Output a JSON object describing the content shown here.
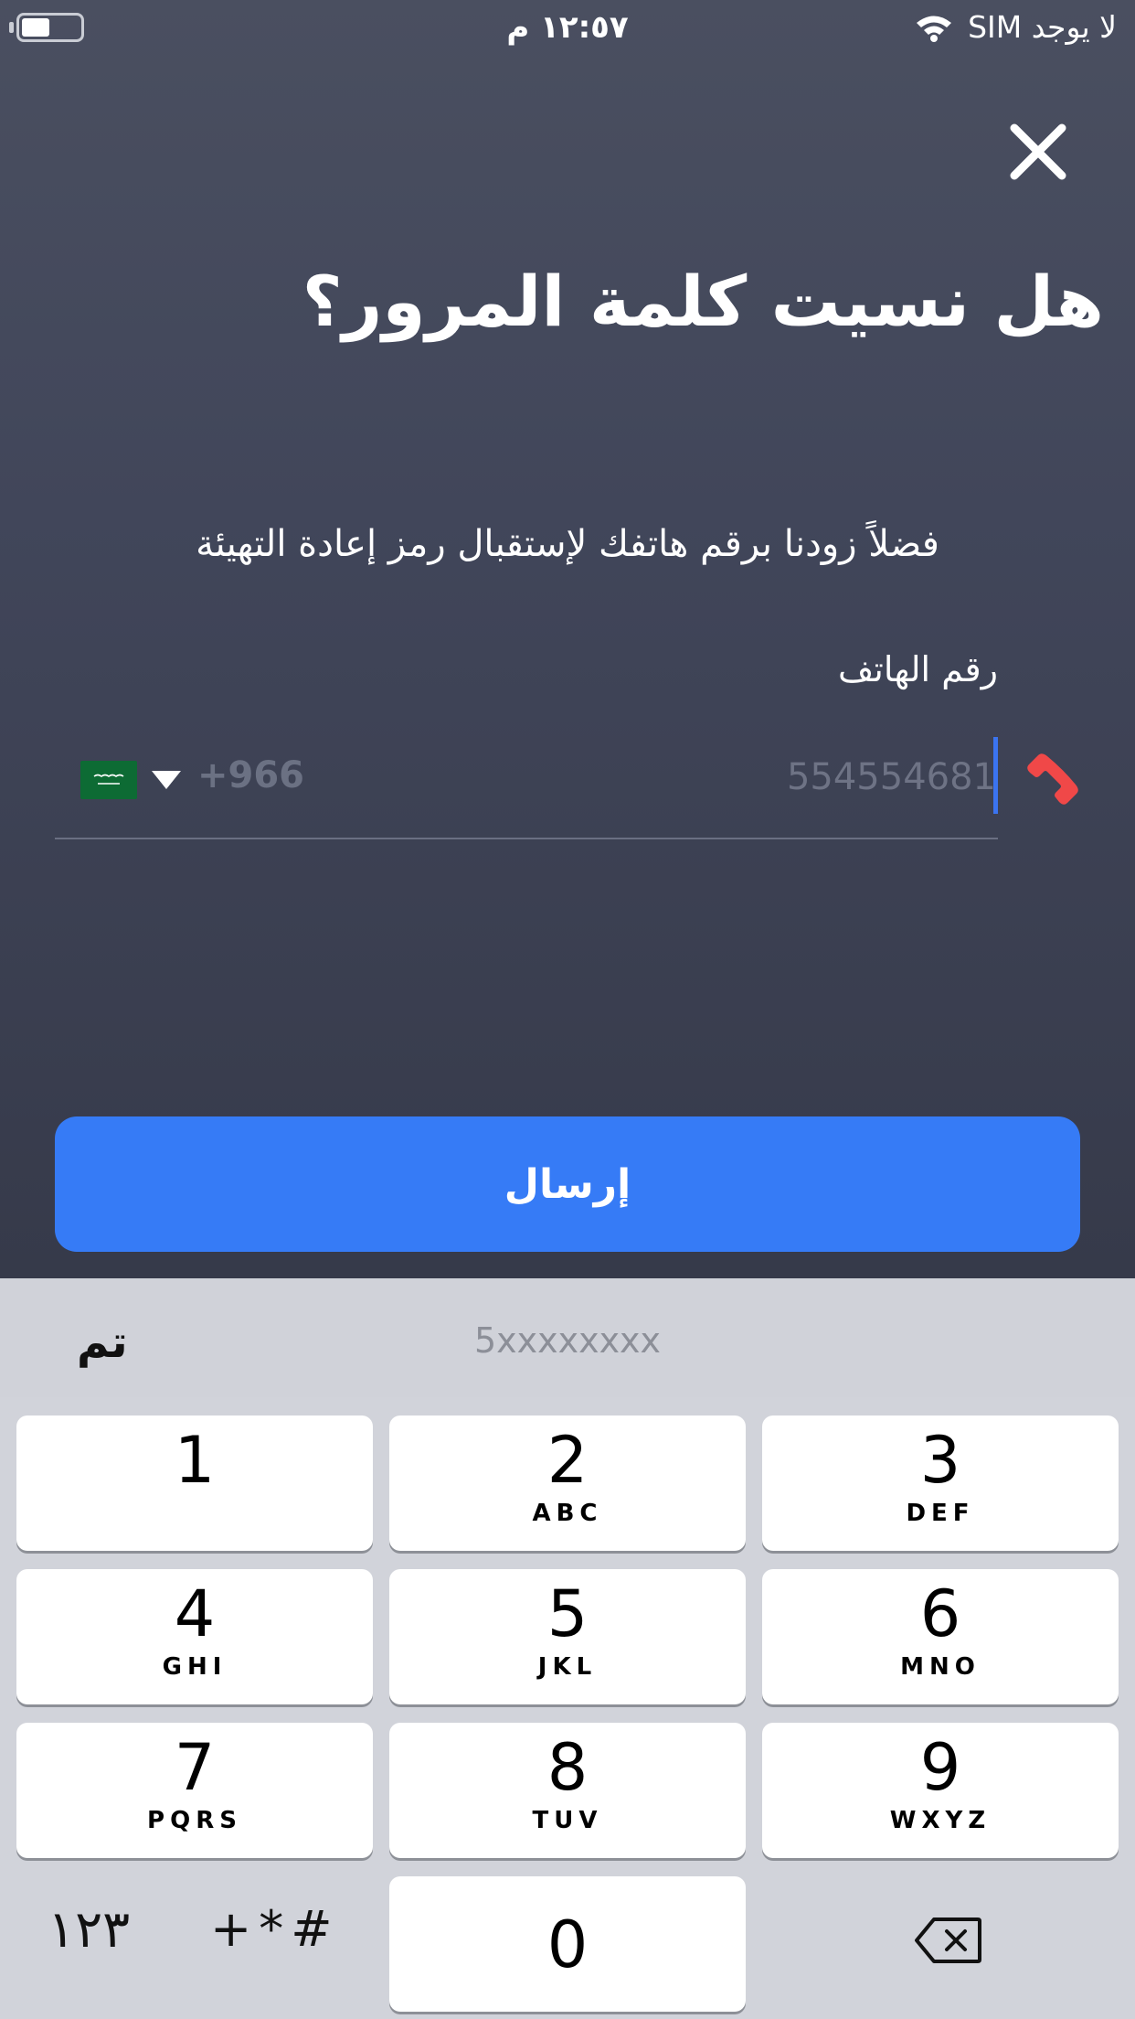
{
  "status_bar": {
    "time": "١٢:٥٧ م",
    "carrier": "لا يوجد SIM"
  },
  "header": {
    "title": "هل نسيت كلمة المرور؟",
    "subtitle": "فضلاً زودنا برقم هاتفك لإستقبال رمز إعادة التهيئة"
  },
  "phone_field": {
    "label": "رقم الهاتف",
    "country_code": "+966",
    "placeholder": "554554681",
    "value": "",
    "flag": "saudi-arabia-flag",
    "icon": "phone-icon",
    "icon_color": "#f04848"
  },
  "actions": {
    "send_label": "إرسال",
    "send_color": "#367bf6"
  },
  "keyboard": {
    "done_label": "تم",
    "hint": "5xxxxxxxx",
    "keys": [
      {
        "digit": "1",
        "letters": ""
      },
      {
        "digit": "2",
        "letters": "ABC"
      },
      {
        "digit": "3",
        "letters": "DEF"
      },
      {
        "digit": "4",
        "letters": "GHI"
      },
      {
        "digit": "5",
        "letters": "JKL"
      },
      {
        "digit": "6",
        "letters": "MNO"
      },
      {
        "digit": "7",
        "letters": "PQRS"
      },
      {
        "digit": "8",
        "letters": "TUV"
      },
      {
        "digit": "9",
        "letters": "WXYZ"
      },
      {
        "digit": "0",
        "letters": ""
      }
    ],
    "mode_label": "١٢٣",
    "symbols_label": "+*#",
    "delete_icon": "delete-backspace-icon"
  }
}
